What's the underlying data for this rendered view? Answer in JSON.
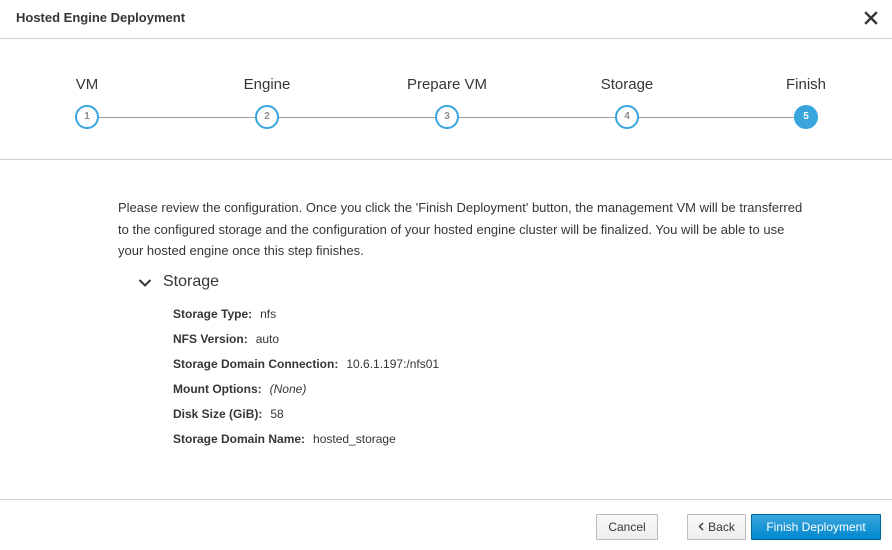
{
  "dialog": {
    "title": "Hosted Engine Deployment",
    "close_icon": "close-icon"
  },
  "wizard": {
    "steps": [
      {
        "label": "VM",
        "number": "1",
        "active": false
      },
      {
        "label": "Engine",
        "number": "2",
        "active": false
      },
      {
        "label": "Prepare VM",
        "number": "3",
        "active": false
      },
      {
        "label": "Storage",
        "number": "4",
        "active": false
      },
      {
        "label": "Finish",
        "number": "5",
        "active": true
      }
    ],
    "accent_color": "#39a5dc"
  },
  "content": {
    "intro": "Please review the configuration. Once you click the 'Finish Deployment' button, the management VM will be transferred to the configured storage and the configuration of your hosted engine cluster will be finalized. You will be able to use your hosted engine once this step finishes.",
    "storage_section": {
      "title": "Storage",
      "expanded": true,
      "toggle_icon": "chevron-down-icon",
      "rows": [
        {
          "label": "Storage Type:",
          "value": "nfs"
        },
        {
          "label": "NFS Version:",
          "value": "auto"
        },
        {
          "label": "Storage Domain Connection:",
          "value": "10.6.1.197:/nfs01"
        },
        {
          "label": "Mount Options:",
          "value": "(None)"
        },
        {
          "label": "Disk Size (GiB):",
          "value": "58"
        },
        {
          "label": "Storage Domain Name:",
          "value": "hosted_storage"
        }
      ]
    }
  },
  "footer": {
    "cancel_label": "Cancel",
    "back_label": "Back",
    "back_icon": "chevron-left-icon",
    "finish_label": "Finish Deployment",
    "primary_color": "#0088ce"
  }
}
